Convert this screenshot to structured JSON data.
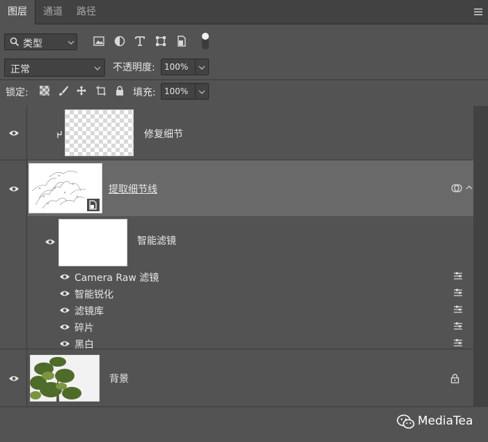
{
  "tabs": [
    {
      "label": "图层"
    },
    {
      "label": "通道"
    },
    {
      "label": "路径"
    }
  ],
  "toolbar": {
    "filter_kind": "类型",
    "blend_mode": "正常",
    "opacity_label": "不透明度:",
    "opacity_value": "100%",
    "lock_label": "锁定:",
    "fill_label": "填充:",
    "fill_value": "100%"
  },
  "layers": {
    "clipped_layer": {
      "name": "修复细节"
    },
    "smart_object": {
      "name": "提取细节线"
    },
    "smart_filters": {
      "label": "智能滤镜",
      "filters": [
        "Camera  Raw 滤镜",
        "智能锐化",
        "滤镜库",
        "碎片",
        "黑白"
      ]
    },
    "background": {
      "name": "背景"
    }
  },
  "watermark": {
    "text": "MediaTea"
  }
}
